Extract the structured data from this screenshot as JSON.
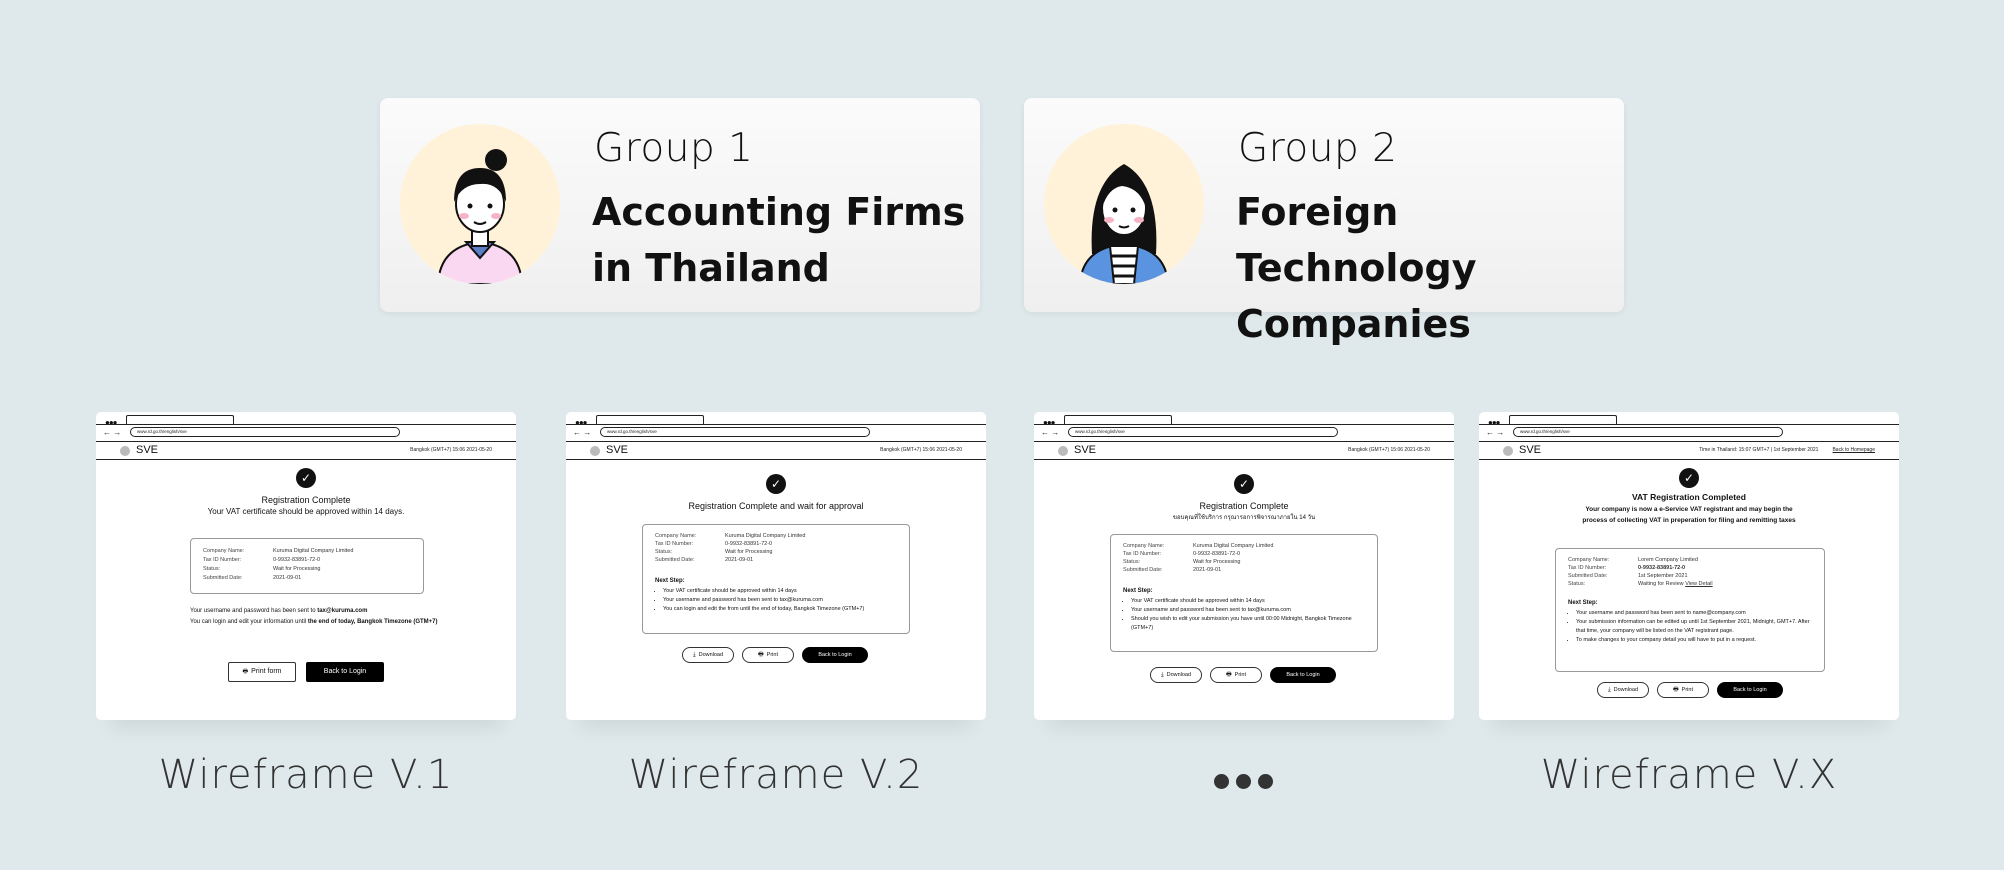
{
  "group1": {
    "label": "Group 1",
    "title_line1": "Accounting Firms",
    "title_line2": "in Thailand"
  },
  "group2": {
    "label": "Group 2",
    "title_line1": "Foreign Technology",
    "title_line2": "Companies"
  },
  "wireframes": {
    "common": {
      "url": "www.rd.go.th/english/sve",
      "brand": "SVE",
      "nav": "← →",
      "dots": "●●●"
    },
    "v1": {
      "meta": "Bangkok (GMT+7)   15:06 2021-05-20",
      "title": "Registration Complete",
      "subtitle": "Your VAT certificate should be approved within 14 days.",
      "rows": [
        {
          "k": "Company Name:",
          "v": "Kuruma Digital Company Limited"
        },
        {
          "k": "Tax ID Number:",
          "v": "0-9932-83891-72-0"
        },
        {
          "k": "Status:",
          "v": "Wait for Processing"
        },
        {
          "k": "Submitted Date:",
          "v": "2021-09-01"
        }
      ],
      "note1_pre": "Your username and password has been sent to ",
      "note1_bold": "tax@kuruma.com",
      "note2_pre": "You can login and edit your information until ",
      "note2_bold": "the end of today, Bangkok Timezone (GTM+7)",
      "btn_print": "Print form",
      "btn_back": "Back to Login"
    },
    "v2": {
      "meta": "Bangkok (GMT+7)   15:06 2021-05-20",
      "title": "Registration Complete and wait for approval",
      "rows": [
        {
          "k": "Company Name:",
          "v": "Kuruma Digital Company Limited"
        },
        {
          "k": "Tax ID Number:",
          "v": "0-9932-83891-72-0"
        },
        {
          "k": "Status:",
          "v": "Wait for Processing"
        },
        {
          "k": "Submitted Date:",
          "v": "2021-09-01"
        }
      ],
      "steps_title": "Next Step:",
      "steps": [
        "Your VAT certificate should be approved within 14 days",
        "Your username and password has been sent to tax@kuruma.com",
        "You can login and edit the from until the end of today, Bangkok Timezone (GTM+7)"
      ],
      "btn_download": "Download",
      "btn_print": "Print",
      "btn_back": "Back to Login"
    },
    "v3": {
      "meta": "Bangkok (GMT+7)   15:06 2021-05-20",
      "title": "Registration Complete",
      "subtitle": "ขอบคุณที่ใช้บริการ กรุณารอการพิจารณาภายใน 14 วัน",
      "rows": [
        {
          "k": "Company Name:",
          "v": "Kuruma Digital Company Limited"
        },
        {
          "k": "Tax ID Number:",
          "v": "0-9932-83891-72-0"
        },
        {
          "k": "Status:",
          "v": "Wait for Processing"
        },
        {
          "k": "Submitted Date:",
          "v": "2021-09-01"
        }
      ],
      "steps_title": "Next Step:",
      "steps": [
        "Your VAT certificate should be approved within 14 days",
        "Your username and password has been sent to tax@kuruma.com",
        "Should you wish to edit your submission you have until 00:00 Midnight, Bangkok Timezone (GTM+7)"
      ],
      "btn_download": "Download",
      "btn_print": "Print",
      "btn_back": "Back to Login"
    },
    "v4": {
      "meta": "Time in Thailand: 15:07 GMT+7 | 1st September 2021",
      "meta_link": "Back to Homepage",
      "title": "VAT Registration Completed",
      "subtitle_line1": "Your company is now a e-Service VAT registrant and may begin the",
      "subtitle_line2": "process of collecting VAT in preperation for filing and remitting taxes",
      "rows": [
        {
          "k": "Company Name:",
          "v": "Lorem Company Limited"
        },
        {
          "k": "Tax ID Number:",
          "v": "0-9932-83891-72-0"
        },
        {
          "k": "Submitted Date:",
          "v": "1st September 2021"
        },
        {
          "k": "Status:",
          "v": "Waiting for Review"
        }
      ],
      "view_detail": "View Detail",
      "steps_title": "Next Step:",
      "steps": [
        "Your username and password has been sent to name@company.com",
        "Your submission information can be edited up until 1st September 2021, Midnight, GMT+7. After that time, your company will be listed on the VAT registrant page.",
        "To make changes to your company detail you will have to put in a request."
      ],
      "btn_download": "Download",
      "btn_print": "Print",
      "btn_back": "Back to Login"
    }
  },
  "captions": {
    "v1": "Wireframe V.1",
    "v2": "Wireframe V.2",
    "vx": "Wireframe V.X"
  }
}
